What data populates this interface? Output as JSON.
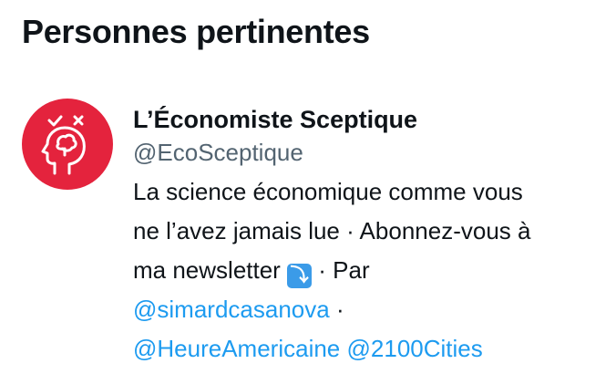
{
  "section": {
    "title": "Personnes pertinentes"
  },
  "person": {
    "name": "L’Économiste Sceptique",
    "handle": "@EcoSceptique",
    "bio": {
      "line1": "La science économique comme vous",
      "line2": "ne l’avez jamais lue · Abonnez-vous à",
      "line3_pre": "ma newsletter ",
      "emoji": "⤵",
      "line3_post": " · Par",
      "mention1": "@simardcasanova",
      "sep": " ·",
      "mention2": "@HeureAmericaine",
      "mention3": "@2100Cities"
    }
  },
  "colors": {
    "accent": "#1d9bf0",
    "avatar_bg": "#e4233d",
    "muted": "#536471"
  },
  "icons": {
    "avatar": "head-brain-check-cross-icon",
    "emoji": "arrow-down-right-emoji-icon"
  }
}
